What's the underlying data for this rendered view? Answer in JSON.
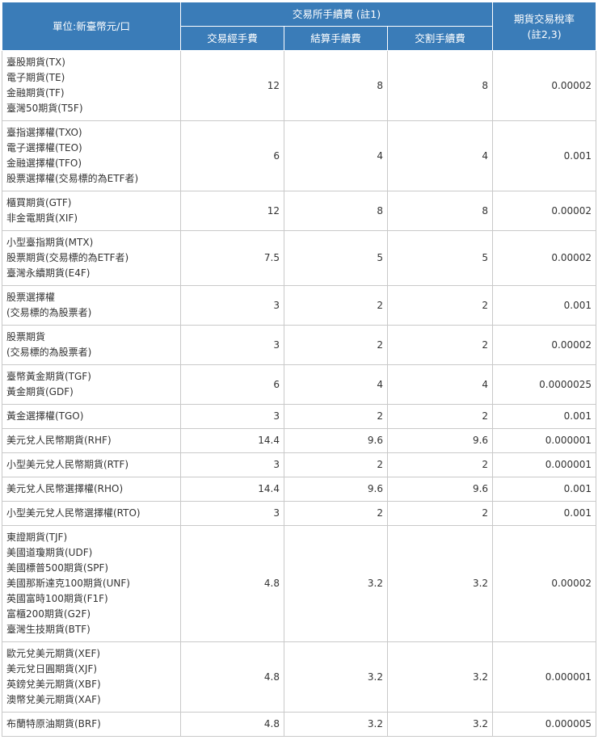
{
  "header": {
    "unit": "單位:新臺幣元/口",
    "exchange_fee_group": "交易所手續費 (註1)",
    "tax_rate": [
      "期貨交易稅率",
      "(註2,3)"
    ],
    "col_trade_fee": "交易經手費",
    "col_clearing_fee": "結算手續費",
    "col_delivery_fee": "交割手續費"
  },
  "rows": [
    {
      "products": [
        "臺股期貨(TX)",
        "電子期貨(TE)",
        "金融期貨(TF)",
        "臺灣50期貨(T5F)"
      ],
      "trade_fee": "12",
      "clearing_fee": "8",
      "delivery_fee": "8",
      "tax_rate": "0.00002"
    },
    {
      "products": [
        "臺指選擇權(TXO)",
        "電子選擇權(TEO)",
        "金融選擇權(TFO)",
        "股票選擇權(交易標的為ETF者)"
      ],
      "trade_fee": "6",
      "clearing_fee": "4",
      "delivery_fee": "4",
      "tax_rate": "0.001"
    },
    {
      "products": [
        "櫃買期貨(GTF)",
        "非金電期貨(XIF)"
      ],
      "trade_fee": "12",
      "clearing_fee": "8",
      "delivery_fee": "8",
      "tax_rate": "0.00002"
    },
    {
      "products": [
        "小型臺指期貨(MTX)",
        "股票期貨(交易標的為ETF者)",
        "臺灣永續期貨(E4F)"
      ],
      "trade_fee": "7.5",
      "clearing_fee": "5",
      "delivery_fee": "5",
      "tax_rate": "0.00002"
    },
    {
      "products": [
        "股票選擇權",
        "(交易標的為股票者)"
      ],
      "trade_fee": "3",
      "clearing_fee": "2",
      "delivery_fee": "2",
      "tax_rate": "0.001"
    },
    {
      "products": [
        "股票期貨",
        "(交易標的為股票者)"
      ],
      "trade_fee": "3",
      "clearing_fee": "2",
      "delivery_fee": "2",
      "tax_rate": "0.00002"
    },
    {
      "products": [
        "臺幣黃金期貨(TGF)",
        "黃金期貨(GDF)"
      ],
      "trade_fee": "6",
      "clearing_fee": "4",
      "delivery_fee": "4",
      "tax_rate": "0.0000025"
    },
    {
      "products": [
        "黃金選擇權(TGO)"
      ],
      "trade_fee": "3",
      "clearing_fee": "2",
      "delivery_fee": "2",
      "tax_rate": "0.001"
    },
    {
      "products": [
        "美元兌人民幣期貨(RHF)"
      ],
      "trade_fee": "14.4",
      "clearing_fee": "9.6",
      "delivery_fee": "9.6",
      "tax_rate": "0.000001"
    },
    {
      "products": [
        "小型美元兌人民幣期貨(RTF)"
      ],
      "trade_fee": "3",
      "clearing_fee": "2",
      "delivery_fee": "2",
      "tax_rate": "0.000001"
    },
    {
      "products": [
        "美元兌人民幣選擇權(RHO)"
      ],
      "trade_fee": "14.4",
      "clearing_fee": "9.6",
      "delivery_fee": "9.6",
      "tax_rate": "0.001"
    },
    {
      "products": [
        "小型美元兌人民幣選擇權(RTO)"
      ],
      "trade_fee": "3",
      "clearing_fee": "2",
      "delivery_fee": "2",
      "tax_rate": "0.001"
    },
    {
      "products": [
        "東證期貨(TJF)",
        "美國道瓊期貨(UDF)",
        "美國標普500期貨(SPF)",
        "美國那斯達克100期貨(UNF)",
        "英國富時100期貨(F1F)",
        "富櫃200期貨(G2F)",
        "臺灣生技期貨(BTF)"
      ],
      "trade_fee": "4.8",
      "clearing_fee": "3.2",
      "delivery_fee": "3.2",
      "tax_rate": "0.00002"
    },
    {
      "products": [
        "歐元兌美元期貨(XEF)",
        "美元兌日圓期貨(XJF)",
        "英鎊兌美元期貨(XBF)",
        "澳幣兌美元期貨(XAF)"
      ],
      "trade_fee": "4.8",
      "clearing_fee": "3.2",
      "delivery_fee": "3.2",
      "tax_rate": "0.000001"
    },
    {
      "products": [
        "布蘭特原油期貨(BRF)"
      ],
      "trade_fee": "4.8",
      "clearing_fee": "3.2",
      "delivery_fee": "3.2",
      "tax_rate": "0.000005"
    }
  ]
}
